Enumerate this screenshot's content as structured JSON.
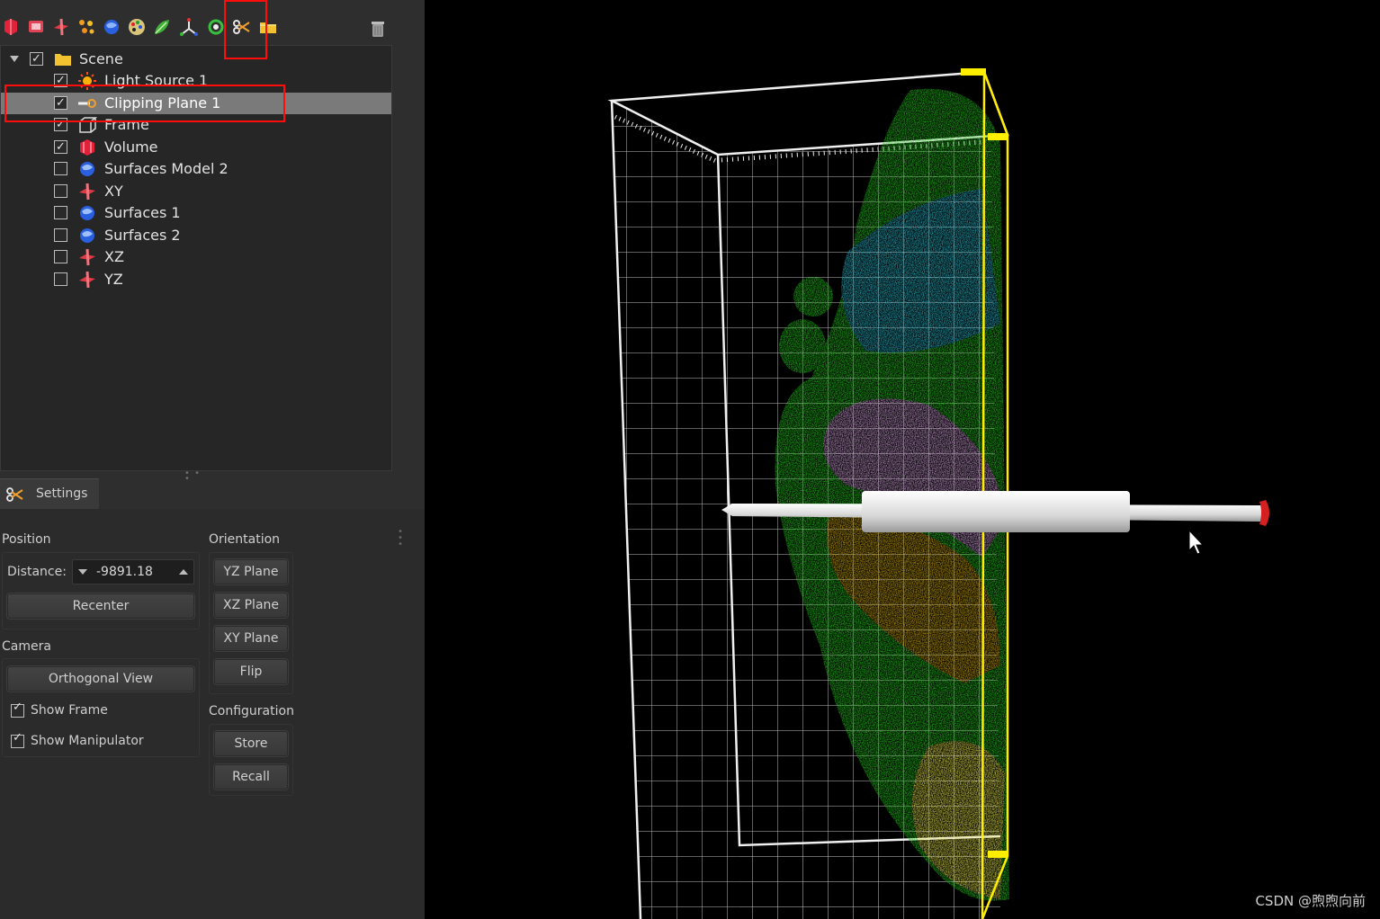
{
  "toolbar": {
    "icons": [
      "volume-icon",
      "frame-icon",
      "plane-icon",
      "spots-icon",
      "surfaces-icon",
      "palette-icon",
      "leaf-icon",
      "axes-icon",
      "refresh-icon",
      "scissors-icon",
      "folder-icon"
    ],
    "trash_icon": "trash-icon"
  },
  "tree": {
    "items": [
      {
        "label": "Scene",
        "checked": true,
        "icon": "folder-icon"
      },
      {
        "label": "Light Source 1",
        "checked": true,
        "icon": "sun-icon"
      },
      {
        "label": "Clipping Plane 1",
        "checked": true,
        "icon": "clipping-plane-icon",
        "selected": true
      },
      {
        "label": "Frame",
        "checked": true,
        "icon": "frame-icon"
      },
      {
        "label": "Volume",
        "checked": true,
        "icon": "volume-icon"
      },
      {
        "label": "Surfaces Model 2",
        "checked": false,
        "icon": "surfaces-icon"
      },
      {
        "label": "XY",
        "checked": false,
        "icon": "plane-icon"
      },
      {
        "label": "Surfaces 1",
        "checked": false,
        "icon": "surfaces-icon"
      },
      {
        "label": "Surfaces 2",
        "checked": false,
        "icon": "surfaces-icon"
      },
      {
        "label": "XZ",
        "checked": false,
        "icon": "plane-icon"
      },
      {
        "label": "YZ",
        "checked": false,
        "icon": "plane-icon"
      }
    ]
  },
  "settings": {
    "tab_label": "Settings",
    "position": {
      "title": "Position",
      "distance_label": "Distance:",
      "distance_value": "-9891.18",
      "recenter": "Recenter"
    },
    "camera": {
      "title": "Camera",
      "orthogonal_view": "Orthogonal View",
      "show_frame": "Show Frame",
      "show_frame_checked": true,
      "show_manipulator": "Show Manipulator",
      "show_manipulator_checked": true
    },
    "orientation": {
      "title": "Orientation",
      "yz_plane": "YZ Plane",
      "xz_plane": "XZ Plane",
      "xy_plane": "XY Plane",
      "flip": "Flip"
    },
    "configuration": {
      "title": "Configuration",
      "store": "Store",
      "recall": "Recall"
    }
  },
  "viewport": {
    "watermark": "CSDN @煦煦向前",
    "colors": {
      "green": "#22c41a",
      "cyan": "#27b5c9",
      "pink": "#c89ad0",
      "orange": "#c9a20a",
      "yellow": "#e3e24a",
      "clip_plane": "#ffee00",
      "grid": "#e8e8e8"
    }
  },
  "colors": {
    "annotation_red": "#ff0d0d",
    "panel_bg": "#2e2e2e",
    "selection": "#7a7a7a"
  }
}
